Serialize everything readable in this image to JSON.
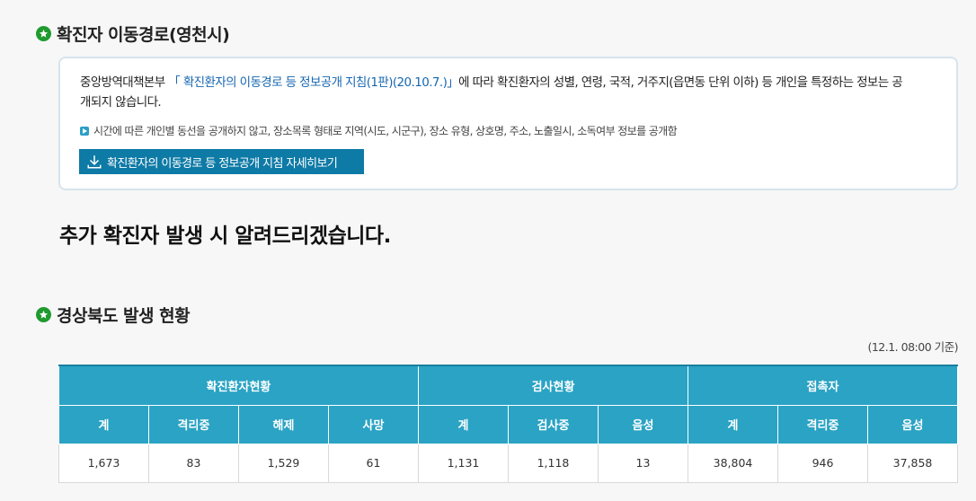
{
  "section1": {
    "title": "확진자 이동경로(영천시)",
    "icon": "star-icon"
  },
  "notice": {
    "text_prefix": "중앙방역대책본부 ",
    "link_text": "「 확진환자의 이동경로 등 정보공개 지침(1판)(20.10.7.)」",
    "text_suffix": "에 따라 확진환자의 성별, 연령, 국적, 거주지(읍면동 단위 이하) 등 개인을 특정하는 정보는 공개되지 않습니다.",
    "bullet": "시간에 따른 개인별 동선을 공개하지 않고, 장소목록 형태로 지역(시도, 시군구), 장소 유형, 상호명, 주소, 노출일시, 소독여부 정보를 공개함",
    "button_label": "확진환자의 이동경로 등 정보공개 지침 자세히보기",
    "button_icon": "download-icon"
  },
  "announcement": "추가 확진자 발생 시 알려드리겠습니다.",
  "section2": {
    "title": "경상북도 발생 현황",
    "icon": "star-icon"
  },
  "basis": "(12.1. 08:00 기준)",
  "table": {
    "groups": [
      "확진환자현황",
      "검사현황",
      "접촉자"
    ],
    "columns": [
      "계",
      "격리중",
      "해제",
      "사망",
      "계",
      "검사중",
      "음성",
      "계",
      "격리중",
      "음성"
    ],
    "row": [
      "1,673",
      "83",
      "1,529",
      "61",
      "1,131",
      "1,118",
      "13",
      "38,804",
      "946",
      "37,858"
    ]
  },
  "colors": {
    "header_bg": "#2aa3c4",
    "button_bg": "#0e7aa6",
    "link": "#1566b0",
    "star": "#1f9a2f"
  }
}
